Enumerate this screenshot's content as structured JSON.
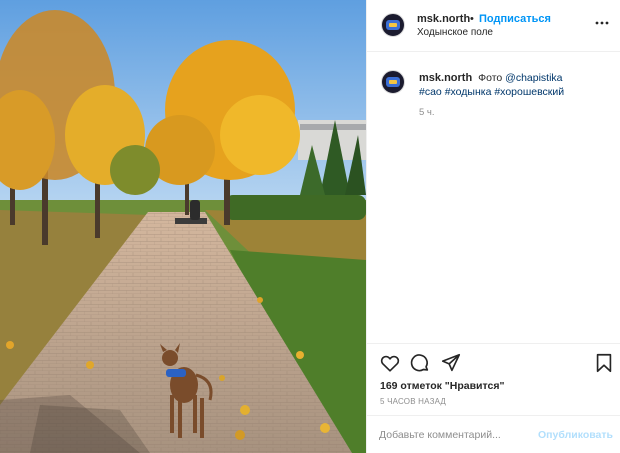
{
  "post": {
    "author": "msk.north",
    "separator": "•",
    "follow_label": "Подписаться",
    "location": "Ходынское поле",
    "more_icon": "more-horizontal-icon",
    "avatar_icon": "avatar-logo"
  },
  "caption": {
    "author": "msk.north",
    "text_prefix": "Фото",
    "mention": "@chapistika",
    "hashtags": [
      "#сао",
      "#ходынка",
      "#хорошевский"
    ],
    "age": "5 ч."
  },
  "actions": {
    "like_icon": "heart-icon",
    "comment_icon": "comment-icon",
    "share_icon": "share-icon",
    "save_icon": "bookmark-icon",
    "likes_text": "169 отметок \"Нравится\"",
    "posted_time": "5 ЧАСОВ НАЗАД"
  },
  "comment": {
    "placeholder": "Добавьте комментарий...",
    "value": "",
    "publish_label": "Опубликовать",
    "publish_color_disabled": "#b2dffc"
  },
  "colors": {
    "accent": "#0095f6",
    "text": "#262626",
    "muted": "#8e8e8e",
    "link": "#00376b",
    "border": "#efefef"
  }
}
